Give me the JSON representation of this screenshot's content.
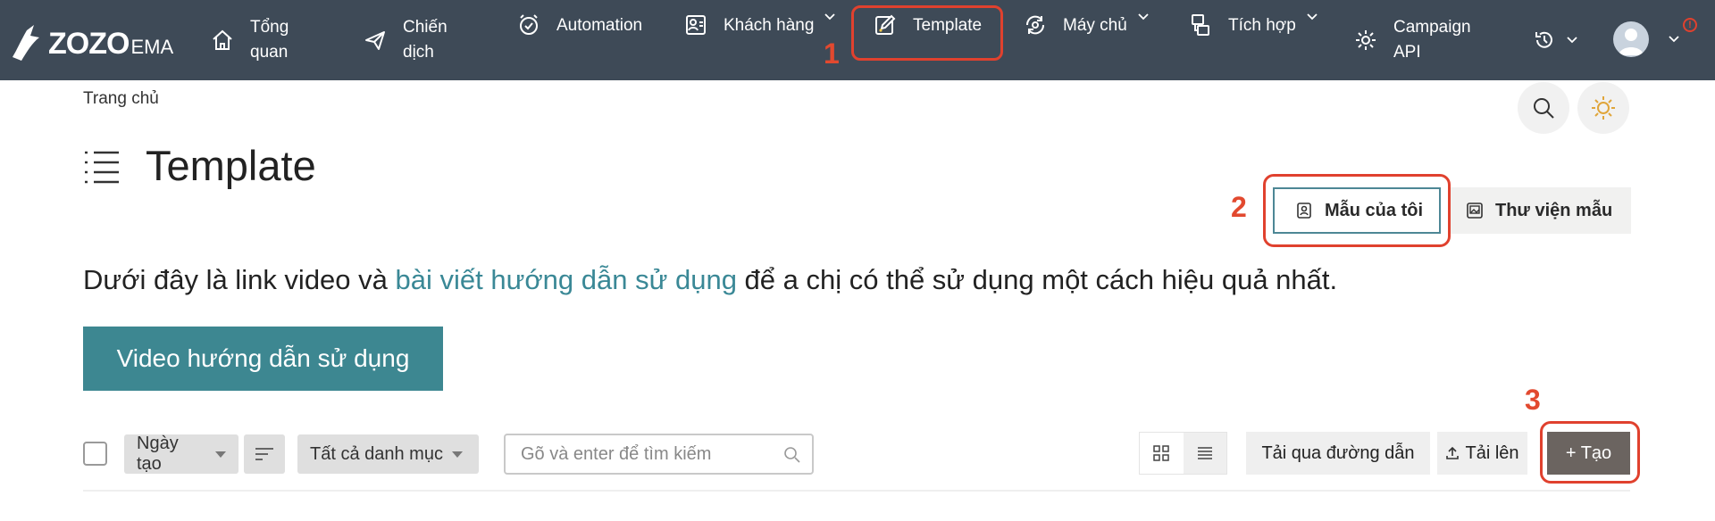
{
  "brand": {
    "name_main": "ZOZO",
    "name_sub": "EMA"
  },
  "nav": {
    "items": [
      {
        "label": "Tổng quan",
        "icon": "home-icon"
      },
      {
        "label": "Chiến dịch",
        "icon": "send-icon"
      },
      {
        "label": "Automation",
        "icon": "alarm-clock-icon"
      },
      {
        "label": "Khách hàng",
        "icon": "contacts-icon"
      },
      {
        "label": "Template",
        "icon": "template-edit-icon"
      },
      {
        "label": "Máy chủ",
        "icon": "server-sync-icon"
      },
      {
        "label": "Tích hợp",
        "icon": "integration-icon"
      },
      {
        "label": "Campaign API",
        "icon": "gear-api-icon"
      }
    ],
    "history_icon": "history-icon",
    "alert_symbol": "!"
  },
  "annotations": {
    "step1": "1",
    "step2": "2",
    "step3": "3",
    "accent_color": "#e0412e"
  },
  "breadcrumb": "Trang chủ",
  "page": {
    "title": "Template",
    "my_templates_label": "Mẫu của tôi",
    "library_label": "Thư viện mẫu",
    "intro_before": "Dưới đây là link video và ",
    "intro_link": "bài viết hướng dẫn sử dụng",
    "intro_after": " để a chị có thể sử dụng một cách hiệu quả nhất.",
    "video_button": "Video hướng dẫn sử dụng"
  },
  "toolbar": {
    "sort_label": "Ngày tạo",
    "category_label": "Tất cả danh mục",
    "search_placeholder": "Gõ và enter để tìm kiếm",
    "url_upload_label": "Tải qua đường dẫn",
    "upload_label": "Tải lên",
    "create_label": "+ Tạo"
  },
  "colors": {
    "topbar": "#3e4a57",
    "teal": "#3d8791",
    "create": "#6b6460"
  }
}
